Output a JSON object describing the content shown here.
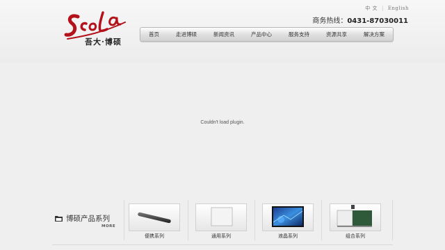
{
  "brand": {
    "logo_text": "ScoLa",
    "logo_sub": "吾大·博硕",
    "red": "#b3121b"
  },
  "lang": {
    "zh": "中 文",
    "en": "English"
  },
  "hotline": {
    "label": "商务热线：",
    "number": "0431-87030011"
  },
  "nav": {
    "items": [
      "首页",
      "走进博硕",
      "新闻资讯",
      "产品中心",
      "服务支持",
      "资源共享",
      "解决方案"
    ]
  },
  "plugin": {
    "message": "Couldn't load plugin."
  },
  "products": {
    "title": "博硕产品系列",
    "more": "MORE",
    "items": [
      {
        "label": "便携系列",
        "icon": "portable-board-icon"
      },
      {
        "label": "通用系列",
        "icon": "whiteboard-icon"
      },
      {
        "label": "液晶系列",
        "icon": "lcd-screen-icon"
      },
      {
        "label": "组合系列",
        "icon": "combo-board-icon"
      }
    ]
  }
}
